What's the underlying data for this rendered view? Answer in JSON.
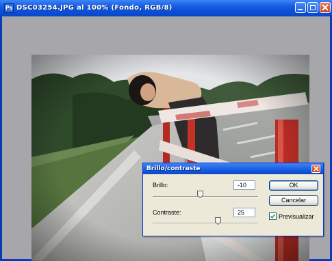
{
  "window": {
    "title": "DSC03254.JPG al 100% (Fondo, RGB/8)",
    "icon": "photoshop-document-icon",
    "icon_glyph": "Ps",
    "controls": [
      "minimize-icon",
      "maximize-icon",
      "close-icon"
    ]
  },
  "canvas": {
    "background_color": "#a6a6ab",
    "image_description_icon": "photo-canvas"
  },
  "dialog": {
    "title": "Brillo/contraste",
    "brightness": {
      "label": "Brillo:",
      "value": "-10",
      "slider_fraction": 0.45
    },
    "contrast": {
      "label": "Contraste:",
      "value": "25",
      "slider_fraction": 0.62
    },
    "ok_label": "OK",
    "cancel_label": "Cancelar",
    "preview": {
      "label": "Previsualizar",
      "checked": true
    }
  },
  "colors": {
    "titlebar": "#0c4fd7",
    "dialog_bg": "#ece9d8",
    "close_button": "#c9401a"
  }
}
